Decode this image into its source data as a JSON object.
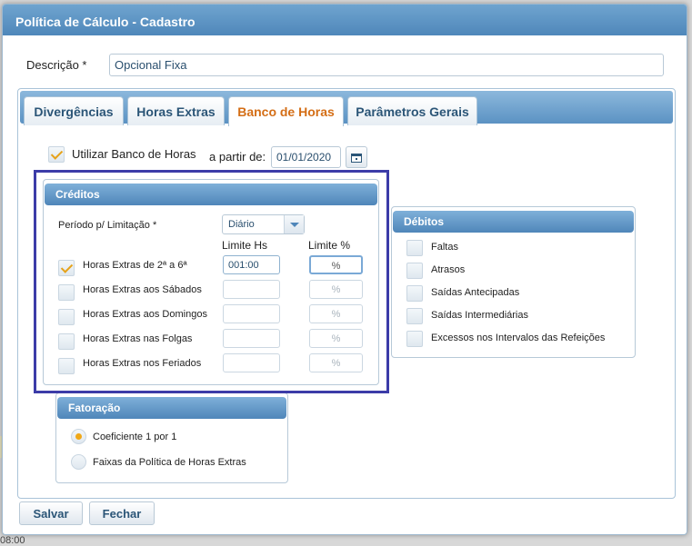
{
  "dialog": {
    "title": "Política de Cálculo - Cadastro"
  },
  "descricao": {
    "label": "Descrição",
    "required_mark": "*",
    "value": "Opcional Fixa"
  },
  "tabs": [
    {
      "label": "Divergências",
      "active": false
    },
    {
      "label": "Horas Extras",
      "active": false
    },
    {
      "label": "Banco de Horas",
      "active": true
    },
    {
      "label": "Parâmetros Gerais",
      "active": false
    }
  ],
  "banco": {
    "use_label": "Utilizar Banco de Horas",
    "use_checked": true,
    "from_label": "a partir de:",
    "from_date": "01/01/2020",
    "calendar_icon": "calendar-icon"
  },
  "creditos": {
    "title": "Créditos",
    "periodo_label": "Período p/ Limitação",
    "periodo_required": "*",
    "periodo_value": "Diário",
    "col_hs": "Limite Hs",
    "col_pct": "Limite %",
    "rows": [
      {
        "label": "Horas Extras de 2ª a 6ª",
        "checked": true,
        "hs": "001:00",
        "pct": "%"
      },
      {
        "label": "Horas Extras aos Sábados",
        "checked": false,
        "hs": "",
        "pct": "%"
      },
      {
        "label": "Horas Extras aos Domingos",
        "checked": false,
        "hs": "",
        "pct": "%"
      },
      {
        "label": "Horas Extras nas Folgas",
        "checked": false,
        "hs": "",
        "pct": "%"
      },
      {
        "label": "Horas Extras nos Feriados",
        "checked": false,
        "hs": "",
        "pct": "%"
      }
    ]
  },
  "debitos": {
    "title": "Débitos",
    "items": [
      {
        "label": "Faltas",
        "checked": false
      },
      {
        "label": "Atrasos",
        "checked": false
      },
      {
        "label": "Saídas Antecipadas",
        "checked": false
      },
      {
        "label": "Saídas Intermediárias",
        "checked": false
      },
      {
        "label": "Excessos nos Intervalos das Refeições",
        "checked": false
      }
    ]
  },
  "fatoracao": {
    "title": "Fatoração",
    "options": [
      {
        "label": "Coeficiente 1 por 1",
        "selected": true
      },
      {
        "label": "Faixas da Política de Horas Extras",
        "selected": false
      }
    ]
  },
  "footer": {
    "save_label": "Salvar",
    "close_label": "Fechar"
  },
  "backdrop": {
    "time_fragment": "08:00"
  },
  "colors": {
    "accent": "#d46e16",
    "header": "#4f87ba",
    "highlight": "#3c3ca8"
  }
}
